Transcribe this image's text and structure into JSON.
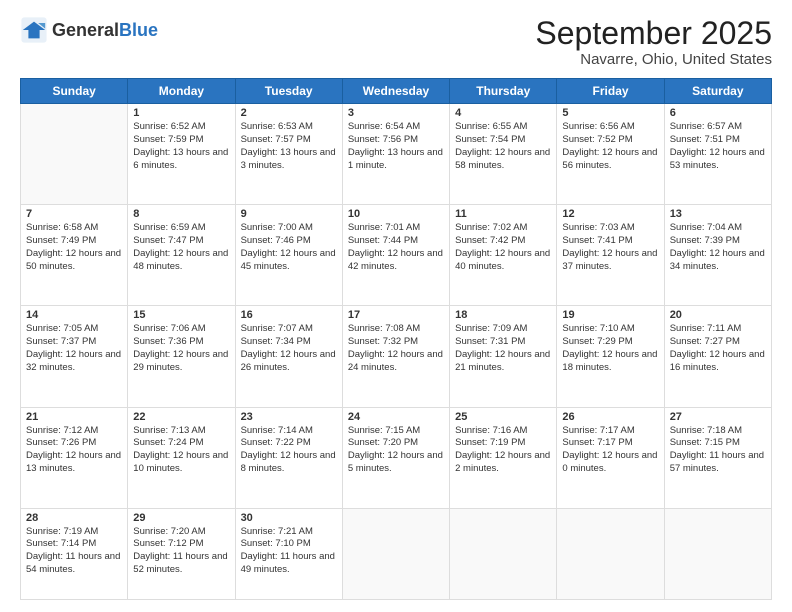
{
  "header": {
    "logo": {
      "general": "General",
      "blue": "Blue"
    },
    "title": "September 2025",
    "location": "Navarre, Ohio, United States"
  },
  "days_of_week": [
    "Sunday",
    "Monday",
    "Tuesday",
    "Wednesday",
    "Thursday",
    "Friday",
    "Saturday"
  ],
  "weeks": [
    [
      {
        "day": "",
        "sunrise": "",
        "sunset": "",
        "daylight": ""
      },
      {
        "day": "1",
        "sunrise": "Sunrise: 6:52 AM",
        "sunset": "Sunset: 7:59 PM",
        "daylight": "Daylight: 13 hours and 6 minutes."
      },
      {
        "day": "2",
        "sunrise": "Sunrise: 6:53 AM",
        "sunset": "Sunset: 7:57 PM",
        "daylight": "Daylight: 13 hours and 3 minutes."
      },
      {
        "day": "3",
        "sunrise": "Sunrise: 6:54 AM",
        "sunset": "Sunset: 7:56 PM",
        "daylight": "Daylight: 13 hours and 1 minute."
      },
      {
        "day": "4",
        "sunrise": "Sunrise: 6:55 AM",
        "sunset": "Sunset: 7:54 PM",
        "daylight": "Daylight: 12 hours and 58 minutes."
      },
      {
        "day": "5",
        "sunrise": "Sunrise: 6:56 AM",
        "sunset": "Sunset: 7:52 PM",
        "daylight": "Daylight: 12 hours and 56 minutes."
      },
      {
        "day": "6",
        "sunrise": "Sunrise: 6:57 AM",
        "sunset": "Sunset: 7:51 PM",
        "daylight": "Daylight: 12 hours and 53 minutes."
      }
    ],
    [
      {
        "day": "7",
        "sunrise": "Sunrise: 6:58 AM",
        "sunset": "Sunset: 7:49 PM",
        "daylight": "Daylight: 12 hours and 50 minutes."
      },
      {
        "day": "8",
        "sunrise": "Sunrise: 6:59 AM",
        "sunset": "Sunset: 7:47 PM",
        "daylight": "Daylight: 12 hours and 48 minutes."
      },
      {
        "day": "9",
        "sunrise": "Sunrise: 7:00 AM",
        "sunset": "Sunset: 7:46 PM",
        "daylight": "Daylight: 12 hours and 45 minutes."
      },
      {
        "day": "10",
        "sunrise": "Sunrise: 7:01 AM",
        "sunset": "Sunset: 7:44 PM",
        "daylight": "Daylight: 12 hours and 42 minutes."
      },
      {
        "day": "11",
        "sunrise": "Sunrise: 7:02 AM",
        "sunset": "Sunset: 7:42 PM",
        "daylight": "Daylight: 12 hours and 40 minutes."
      },
      {
        "day": "12",
        "sunrise": "Sunrise: 7:03 AM",
        "sunset": "Sunset: 7:41 PM",
        "daylight": "Daylight: 12 hours and 37 minutes."
      },
      {
        "day": "13",
        "sunrise": "Sunrise: 7:04 AM",
        "sunset": "Sunset: 7:39 PM",
        "daylight": "Daylight: 12 hours and 34 minutes."
      }
    ],
    [
      {
        "day": "14",
        "sunrise": "Sunrise: 7:05 AM",
        "sunset": "Sunset: 7:37 PM",
        "daylight": "Daylight: 12 hours and 32 minutes."
      },
      {
        "day": "15",
        "sunrise": "Sunrise: 7:06 AM",
        "sunset": "Sunset: 7:36 PM",
        "daylight": "Daylight: 12 hours and 29 minutes."
      },
      {
        "day": "16",
        "sunrise": "Sunrise: 7:07 AM",
        "sunset": "Sunset: 7:34 PM",
        "daylight": "Daylight: 12 hours and 26 minutes."
      },
      {
        "day": "17",
        "sunrise": "Sunrise: 7:08 AM",
        "sunset": "Sunset: 7:32 PM",
        "daylight": "Daylight: 12 hours and 24 minutes."
      },
      {
        "day": "18",
        "sunrise": "Sunrise: 7:09 AM",
        "sunset": "Sunset: 7:31 PM",
        "daylight": "Daylight: 12 hours and 21 minutes."
      },
      {
        "day": "19",
        "sunrise": "Sunrise: 7:10 AM",
        "sunset": "Sunset: 7:29 PM",
        "daylight": "Daylight: 12 hours and 18 minutes."
      },
      {
        "day": "20",
        "sunrise": "Sunrise: 7:11 AM",
        "sunset": "Sunset: 7:27 PM",
        "daylight": "Daylight: 12 hours and 16 minutes."
      }
    ],
    [
      {
        "day": "21",
        "sunrise": "Sunrise: 7:12 AM",
        "sunset": "Sunset: 7:26 PM",
        "daylight": "Daylight: 12 hours and 13 minutes."
      },
      {
        "day": "22",
        "sunrise": "Sunrise: 7:13 AM",
        "sunset": "Sunset: 7:24 PM",
        "daylight": "Daylight: 12 hours and 10 minutes."
      },
      {
        "day": "23",
        "sunrise": "Sunrise: 7:14 AM",
        "sunset": "Sunset: 7:22 PM",
        "daylight": "Daylight: 12 hours and 8 minutes."
      },
      {
        "day": "24",
        "sunrise": "Sunrise: 7:15 AM",
        "sunset": "Sunset: 7:20 PM",
        "daylight": "Daylight: 12 hours and 5 minutes."
      },
      {
        "day": "25",
        "sunrise": "Sunrise: 7:16 AM",
        "sunset": "Sunset: 7:19 PM",
        "daylight": "Daylight: 12 hours and 2 minutes."
      },
      {
        "day": "26",
        "sunrise": "Sunrise: 7:17 AM",
        "sunset": "Sunset: 7:17 PM",
        "daylight": "Daylight: 12 hours and 0 minutes."
      },
      {
        "day": "27",
        "sunrise": "Sunrise: 7:18 AM",
        "sunset": "Sunset: 7:15 PM",
        "daylight": "Daylight: 11 hours and 57 minutes."
      }
    ],
    [
      {
        "day": "28",
        "sunrise": "Sunrise: 7:19 AM",
        "sunset": "Sunset: 7:14 PM",
        "daylight": "Daylight: 11 hours and 54 minutes."
      },
      {
        "day": "29",
        "sunrise": "Sunrise: 7:20 AM",
        "sunset": "Sunset: 7:12 PM",
        "daylight": "Daylight: 11 hours and 52 minutes."
      },
      {
        "day": "30",
        "sunrise": "Sunrise: 7:21 AM",
        "sunset": "Sunset: 7:10 PM",
        "daylight": "Daylight: 11 hours and 49 minutes."
      },
      {
        "day": "",
        "sunrise": "",
        "sunset": "",
        "daylight": ""
      },
      {
        "day": "",
        "sunrise": "",
        "sunset": "",
        "daylight": ""
      },
      {
        "day": "",
        "sunrise": "",
        "sunset": "",
        "daylight": ""
      },
      {
        "day": "",
        "sunrise": "",
        "sunset": "",
        "daylight": ""
      }
    ]
  ]
}
